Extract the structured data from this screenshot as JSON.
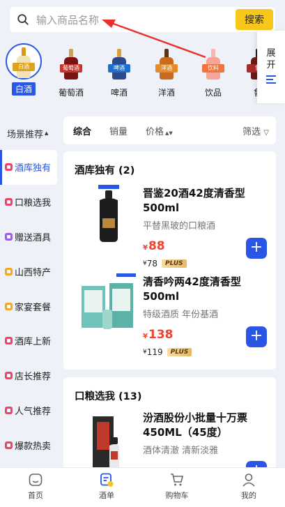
{
  "search": {
    "placeholder": "输入商品名称",
    "button": "搜索"
  },
  "categories": [
    {
      "label": "白酒",
      "tag": "白酒",
      "color": "#e9b23b",
      "selected": true
    },
    {
      "label": "葡萄酒",
      "tag": "葡萄酒",
      "color": "#9b1d1d"
    },
    {
      "label": "啤酒",
      "tag": "啤酒",
      "color": "#b5561b"
    },
    {
      "label": "洋酒",
      "tag": "洋酒",
      "color": "#c86b1c"
    },
    {
      "label": "饮品",
      "tag": "饮料",
      "color": "#f0743c"
    },
    {
      "label": "鲁",
      "tag": "鲁",
      "color": "#6b1a1a"
    }
  ],
  "expand_label": "展开",
  "sidebar": {
    "header": "场景推荐",
    "items": [
      {
        "label": "酒库独有",
        "color": "#f0436a",
        "selected": true
      },
      {
        "label": "口粮选我",
        "color": "#f0436a"
      },
      {
        "label": "赠送酒具",
        "color": "#9b5cf0"
      },
      {
        "label": "山西特产",
        "color": "#f5a623"
      },
      {
        "label": "家宴套餐",
        "color": "#f5a623"
      },
      {
        "label": "酒库上新",
        "color": "#f0436a"
      },
      {
        "label": "店长推荐",
        "color": "#f0436a"
      },
      {
        "label": "人气推荐",
        "color": "#f0436a"
      },
      {
        "label": "爆款热卖",
        "color": "#f0436a"
      }
    ]
  },
  "filter": {
    "all": "综合",
    "sales": "销量",
    "price": "价格",
    "screen": "筛选"
  },
  "sections": [
    {
      "title": "酒库独有 (2)",
      "products": [
        {
          "name": "晋鉴20酒42度清香型500ml",
          "desc": "平替黑玻的口粮酒",
          "price": "88",
          "plus_price": "78",
          "plus_tag": "PLUS"
        },
        {
          "name": "清香吟两42度清香型500ml",
          "desc": "特级酒质 年份基酒",
          "price": "138",
          "plus_price": "119",
          "plus_tag": "PLUS"
        }
      ]
    },
    {
      "title": "口粮选我 (13)",
      "products": [
        {
          "name": "汾酒股份小批量十万票450ML（45度）",
          "desc": "酒体清澈 清新淡雅"
        }
      ]
    }
  ],
  "currency": "¥",
  "tabs": [
    {
      "label": "首页"
    },
    {
      "label": "酒单",
      "active": true
    },
    {
      "label": "购物车"
    },
    {
      "label": "我的"
    }
  ],
  "colors": {
    "accent": "#2a56e6",
    "price": "#f0432e",
    "search_button": "#f7c71b"
  }
}
